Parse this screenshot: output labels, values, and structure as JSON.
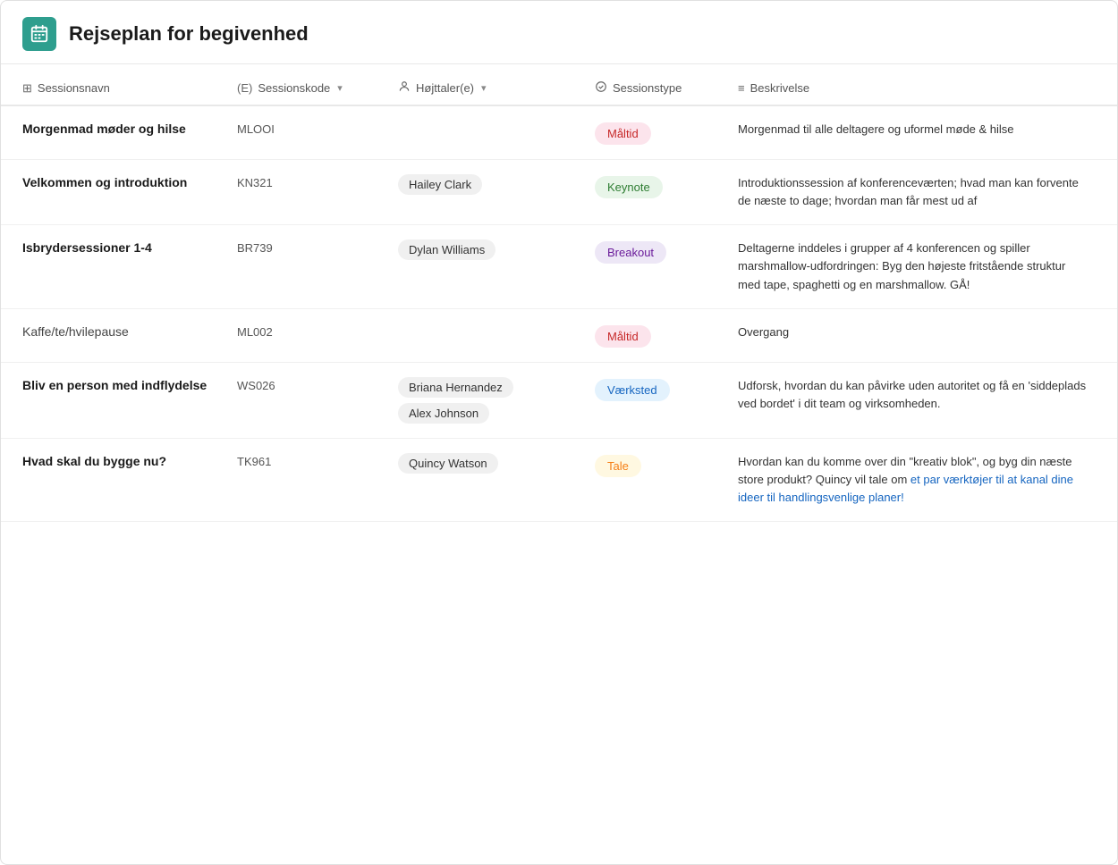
{
  "header": {
    "title": "Rejseplan for begivenhed",
    "icon_label": "calendar-icon"
  },
  "columns": [
    {
      "label": "Sessionsnavn",
      "icon": "⊞",
      "has_chevron": false
    },
    {
      "label": "Sessionskode",
      "icon": "(E)",
      "has_chevron": true
    },
    {
      "label": "Højttaler(e)",
      "icon": "👤",
      "has_chevron": true
    },
    {
      "label": "Sessionstype",
      "icon": "✓",
      "has_chevron": false
    },
    {
      "label": "Beskrivelse",
      "icon": "≡",
      "has_chevron": false
    }
  ],
  "rows": [
    {
      "name": "Morgenmad møder og hilse",
      "name_bold": true,
      "code": "MLOOI",
      "speakers": [],
      "type": "Måltid",
      "type_class": "type-mealtime",
      "description": "Morgenmad til alle deltagere og uformel møde &amp; hilse",
      "description_has_highlight": false
    },
    {
      "name": "Velkommen og introduktion",
      "name_bold": true,
      "code": "KN321",
      "speakers": [
        "Hailey Clark"
      ],
      "type": "Keynote",
      "type_class": "type-keynote",
      "description": "Introduktionssession af konferenceværten; hvad man kan forvente de næste to dage; hvordan man får mest ud af",
      "description_has_highlight": false
    },
    {
      "name": "Isbrydersessioner 1-4",
      "name_bold": true,
      "code": "BR739",
      "speakers": [
        "Dylan Williams"
      ],
      "type": "Breakout",
      "type_class": "type-breakout",
      "description": "Deltagerne inddeles i grupper af 4 konferencen og spiller marshmallow-udfordringen: Byg den højeste fritstående struktur med tape, spaghetti og en marshmallow. GÅ!",
      "description_has_highlight": false
    },
    {
      "name": "Kaffe/te/hvilepause",
      "name_bold": false,
      "code": "ML002",
      "speakers": [],
      "type": "Måltid",
      "type_class": "type-mealtime",
      "description": "Overgang",
      "description_has_highlight": false
    },
    {
      "name": "Bliv en person med indflydelse",
      "name_bold": true,
      "code": "WS026",
      "speakers": [
        "Briana  Hernandez",
        "Alex Johnson"
      ],
      "type": "Værksted",
      "type_class": "type-workshop",
      "description": "Udforsk, hvordan du kan påvirke uden autoritet og få en 'siddeplads ved bordet' i dit team og virksomheden.",
      "description_has_highlight": false
    },
    {
      "name": "Hvad skal du bygge nu?",
      "name_bold": true,
      "code": "TK961",
      "speakers": [
        "Quincy Watson"
      ],
      "type": "Tale",
      "type_class": "type-talk",
      "description_parts": [
        {
          "text": "Hvordan kan du komme over din \"kreativ blok\", og byg din næste store produkt? Quincy vil tale om ",
          "highlight": false
        },
        {
          "text": "et par værktøjer til at kanal dine ideer til handlingsvenlige planer!",
          "highlight": true
        }
      ],
      "description_has_highlight": true
    }
  ]
}
